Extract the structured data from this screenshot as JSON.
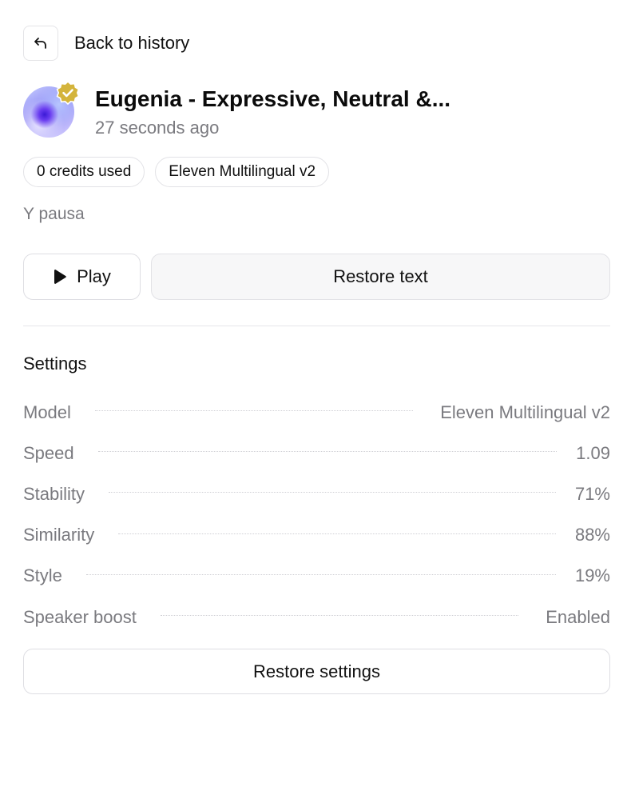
{
  "nav": {
    "back_label": "Back to history",
    "back_icon": "undo-arrow-icon"
  },
  "voice": {
    "title": "Eugenia - Expressive, Neutral &...",
    "timestamp": "27 seconds ago",
    "badge_icon": "verified-badge-icon",
    "badge_color": "#D4B43C"
  },
  "pills": {
    "credits": "0 credits used",
    "model": "Eleven Multilingual v2"
  },
  "text_preview": "Y pausa",
  "actions": {
    "play_label": "Play",
    "play_icon": "play-icon",
    "restore_text_label": "Restore text"
  },
  "settings": {
    "heading": "Settings",
    "rows": [
      {
        "label": "Model",
        "value": "Eleven Multilingual v2"
      },
      {
        "label": "Speed",
        "value": "1.09"
      },
      {
        "label": "Stability",
        "value": "71%"
      },
      {
        "label": "Similarity",
        "value": "88%"
      },
      {
        "label": "Style",
        "value": "19%"
      },
      {
        "label": "Speaker boost",
        "value": "Enabled"
      }
    ],
    "restore_label": "Restore settings"
  }
}
